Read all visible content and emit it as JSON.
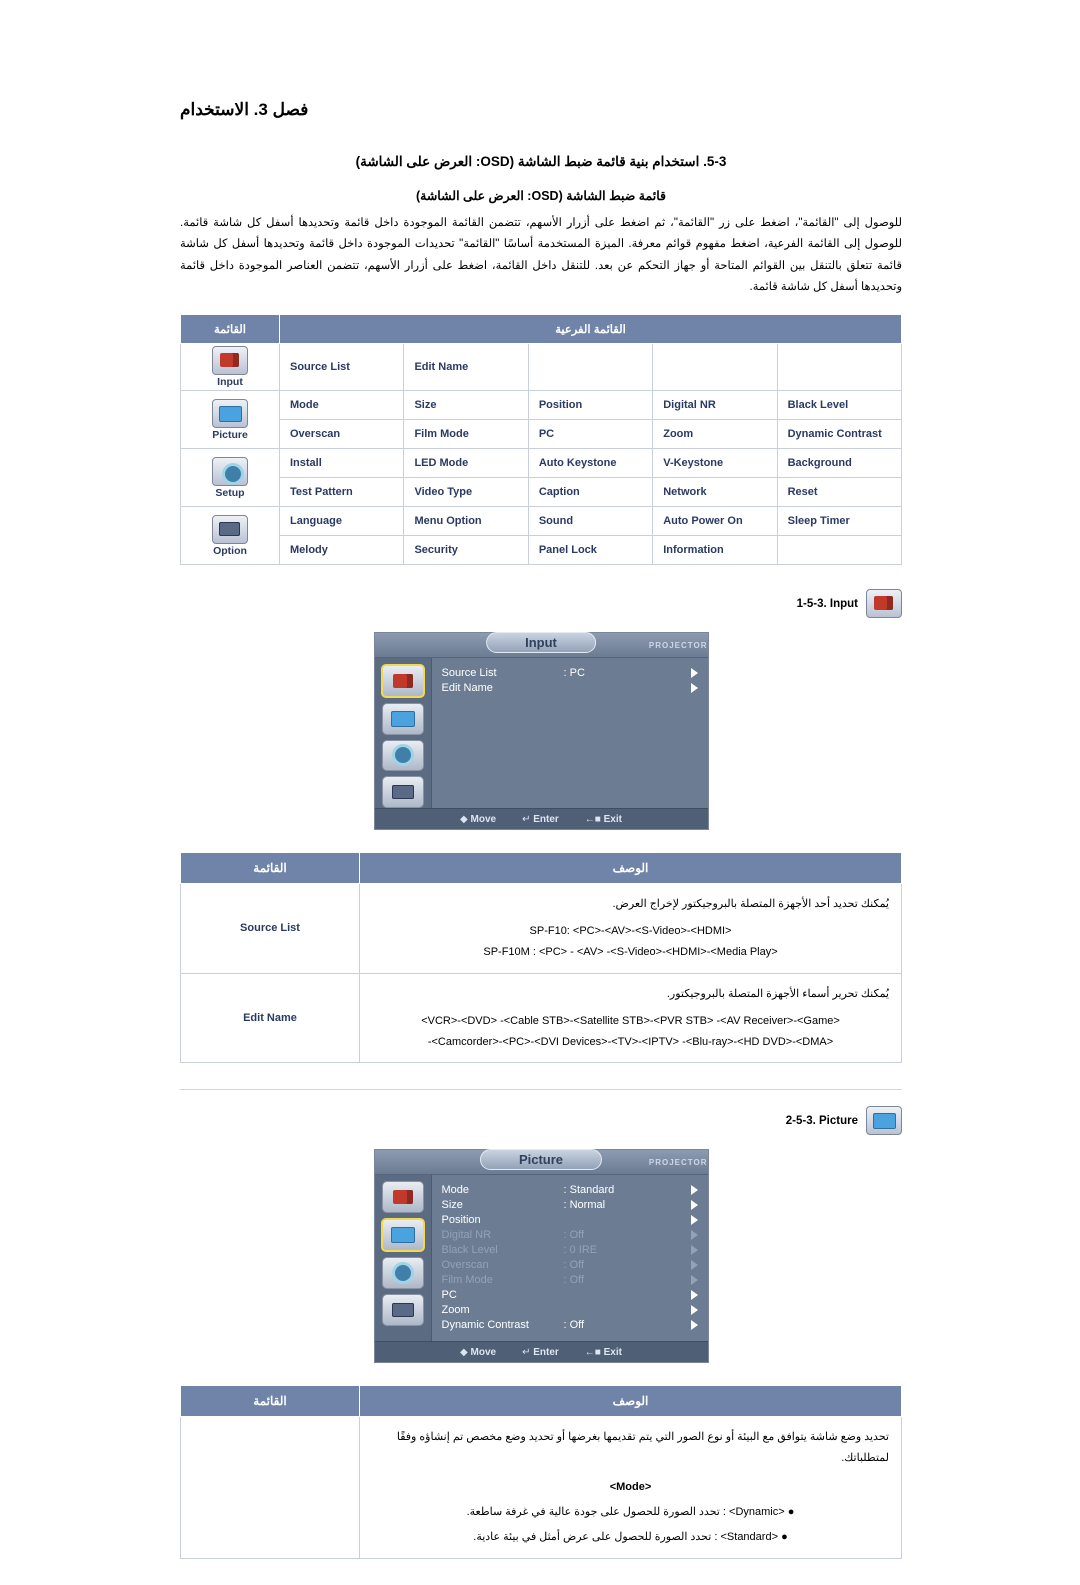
{
  "chapter_title": "فصل 3. الاستخدام",
  "section_title": "5-3. استخدام بنية قائمة ضبط الشاشة (OSD: العرض على الشاشة)",
  "sub_title": "قائمة ضبط الشاشة (OSD: العرض على الشاشة)",
  "intro_paragraph": "للوصول إلى \"القائمة\"، اضغط على زر \"القائمة\"، ثم اضغط على أزرار الأسهم، تتضمن القائمة الموجودة داخل قائمة وتحديدها أسفل كل شاشة قائمة. للوصول إلى القائمة الفرعية، اضغط مفهوم قوائم معرفة. الميزة المستخدمة أساسًا \"القائمة\" تحديدات الموجودة داخل قائمة وتحديدها أسفل كل شاشة قائمة تتعلق بالتنقل بين القوائم المتاحة أو جهاز التحكم عن بعد. للتنقل داخل القائمة، اضغط على أزرار الأسهم، تتضمن العناصر الموجودة داخل قائمة وتحديدها أسفل كل شاشة قائمة.",
  "menumap": {
    "header_sub": "القائمة الفرعية",
    "header_main": "القائمة",
    "rows": [
      {
        "cells": [
          "",
          "",
          "",
          "Edit Name",
          "Source List"
        ],
        "icon": "input-icon",
        "icon_label": "Input",
        "icon_class": "input"
      },
      {
        "cells": [
          "Black Level",
          "Digital NR",
          "Position",
          "Size",
          "Mode"
        ],
        "icon": "picture-icon",
        "icon_label": "Picture",
        "icon_class": "picture",
        "rowspan_start": true
      },
      {
        "cells": [
          "Dynamic Contrast",
          "Zoom",
          "PC",
          "Film Mode",
          "Overscan"
        ]
      },
      {
        "cells": [
          "Background",
          "V-Keystone",
          "Auto Keystone",
          "LED Mode",
          "Install"
        ],
        "icon": "setup-icon",
        "icon_label": "Setup",
        "icon_class": "setup"
      },
      {
        "cells": [
          "Reset",
          "Network",
          "Caption",
          "Video Type",
          "Test Pattern"
        ]
      },
      {
        "cells": [
          "Sleep Timer",
          "Auto Power On",
          "Sound",
          "Menu Option",
          "Language"
        ],
        "icon": "option-icon",
        "icon_label": "Option",
        "icon_class": "option"
      },
      {
        "cells": [
          "",
          "Information",
          "Panel Lock",
          "Security",
          "Melody"
        ]
      }
    ]
  },
  "input_section": {
    "tag_label": "1-5-3. Input",
    "osd": {
      "brand": "PROJECTOR",
      "title": "Input",
      "rows": [
        {
          "name": "Source List",
          "value": ": PC",
          "state": "normal"
        },
        {
          "name": "Edit Name",
          "value": "",
          "state": "normal"
        }
      ],
      "footer": {
        "move": "Move",
        "enter": "Enter",
        "exit": "Exit"
      }
    },
    "table": {
      "header_desc": "الوصف",
      "header_menu": "القائمة",
      "rows": [
        {
          "name": "Source List",
          "desc": "يُمكنك تحديد أحد الأجهزة المتصلة بالبروجيكتور لإخراج العرض.",
          "chain1": "SP-F10: <PC>-<AV>-<S-Video>-<HDMI>",
          "chain2": "SP-F10M : <PC> - <AV> -<S-Video>-<HDMI>-<Media Play>"
        },
        {
          "name": "Edit Name",
          "desc": "يُمكنك تحرير أسماء الأجهزة المتصلة بالبروجيكتور.",
          "chain1": "<VCR>-<DVD> -<Cable STB>-<Satellite STB>-<PVR STB> -<AV Receiver>-<Game>",
          "chain2": "-<Camcorder>-<PC>-<DVI Devices>-<TV>-<IPTV> -<Blu-ray>-<HD DVD>-<DMA>"
        }
      ]
    }
  },
  "picture_section": {
    "tag_label": "2-5-3. Picture",
    "osd": {
      "brand": "PROJECTOR",
      "title": "Picture",
      "rows": [
        {
          "name": "Mode",
          "value": ": Standard",
          "state": "normal"
        },
        {
          "name": "Size",
          "value": ": Normal",
          "state": "normal"
        },
        {
          "name": "Position",
          "value": "",
          "state": "normal"
        },
        {
          "name": "Digital NR",
          "value": ": Off",
          "state": "dim"
        },
        {
          "name": "Black Level",
          "value": ": 0 IRE",
          "state": "dim"
        },
        {
          "name": "Overscan",
          "value": ": Off",
          "state": "dim"
        },
        {
          "name": "Film Mode",
          "value": ": Off",
          "state": "dim"
        },
        {
          "name": "PC",
          "value": "",
          "state": "normal"
        },
        {
          "name": "Zoom",
          "value": "",
          "state": "normal"
        },
        {
          "name": "Dynamic Contrast",
          "value": ": Off",
          "state": "normal"
        }
      ],
      "footer": {
        "move": "Move",
        "enter": "Enter",
        "exit": "Exit"
      }
    },
    "table": {
      "header_desc": "الوصف",
      "header_menu": "القائمة",
      "row": {
        "name_tag": "<Mode>",
        "desc": "تحديد وضع شاشة يتوافق مع البيئة أو نوع الصور التي يتم تقديمها بغرضها أو تحديد وضع مخصص تم إنشاؤه وفقًا لمتطلباتك.",
        "bullets": [
          "<Dynamic> : تحدد الصورة للحصول على جودة عالية في غرفة ساطعة.",
          "<Standard> : تحدد الصورة للحصول على عرض أمثل في بيئة عادية."
        ]
      }
    }
  }
}
